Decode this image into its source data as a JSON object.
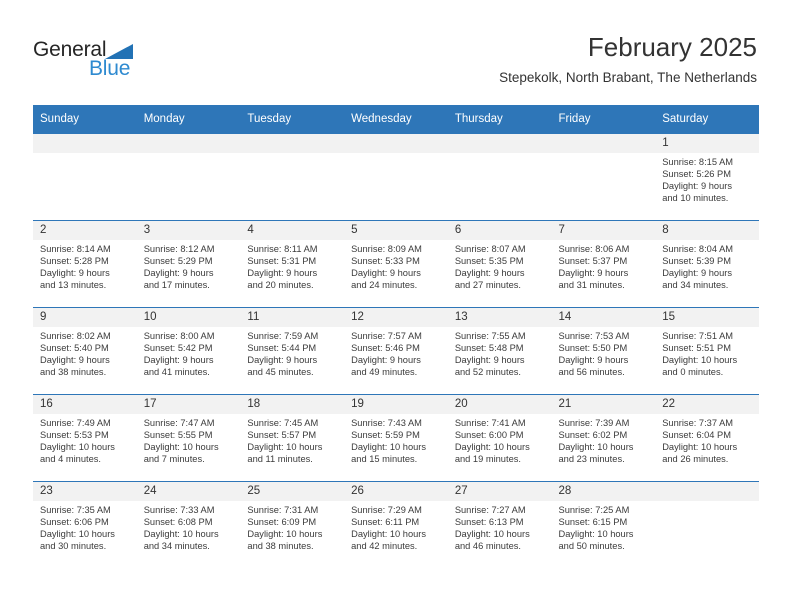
{
  "brand": {
    "name_part1": "General",
    "name_part2": "Blue",
    "triangle_icon": "triangle-icon",
    "accent_color": "#2e76b8",
    "logo_blue": "#2e8ad0"
  },
  "header": {
    "title": "February 2025",
    "subtitle": "Stepekolk, North Brabant, The Netherlands"
  },
  "calendar": {
    "weekday_headers": [
      "Sunday",
      "Monday",
      "Tuesday",
      "Wednesday",
      "Thursday",
      "Friday",
      "Saturday"
    ],
    "weeks": [
      [
        {
          "day": "",
          "lines": []
        },
        {
          "day": "",
          "lines": []
        },
        {
          "day": "",
          "lines": []
        },
        {
          "day": "",
          "lines": []
        },
        {
          "day": "",
          "lines": []
        },
        {
          "day": "",
          "lines": []
        },
        {
          "day": "1",
          "lines": [
            "Sunrise: 8:15 AM",
            "Sunset: 5:26 PM",
            "Daylight: 9 hours",
            "and 10 minutes."
          ]
        }
      ],
      [
        {
          "day": "2",
          "lines": [
            "Sunrise: 8:14 AM",
            "Sunset: 5:28 PM",
            "Daylight: 9 hours",
            "and 13 minutes."
          ]
        },
        {
          "day": "3",
          "lines": [
            "Sunrise: 8:12 AM",
            "Sunset: 5:29 PM",
            "Daylight: 9 hours",
            "and 17 minutes."
          ]
        },
        {
          "day": "4",
          "lines": [
            "Sunrise: 8:11 AM",
            "Sunset: 5:31 PM",
            "Daylight: 9 hours",
            "and 20 minutes."
          ]
        },
        {
          "day": "5",
          "lines": [
            "Sunrise: 8:09 AM",
            "Sunset: 5:33 PM",
            "Daylight: 9 hours",
            "and 24 minutes."
          ]
        },
        {
          "day": "6",
          "lines": [
            "Sunrise: 8:07 AM",
            "Sunset: 5:35 PM",
            "Daylight: 9 hours",
            "and 27 minutes."
          ]
        },
        {
          "day": "7",
          "lines": [
            "Sunrise: 8:06 AM",
            "Sunset: 5:37 PM",
            "Daylight: 9 hours",
            "and 31 minutes."
          ]
        },
        {
          "day": "8",
          "lines": [
            "Sunrise: 8:04 AM",
            "Sunset: 5:39 PM",
            "Daylight: 9 hours",
            "and 34 minutes."
          ]
        }
      ],
      [
        {
          "day": "9",
          "lines": [
            "Sunrise: 8:02 AM",
            "Sunset: 5:40 PM",
            "Daylight: 9 hours",
            "and 38 minutes."
          ]
        },
        {
          "day": "10",
          "lines": [
            "Sunrise: 8:00 AM",
            "Sunset: 5:42 PM",
            "Daylight: 9 hours",
            "and 41 minutes."
          ]
        },
        {
          "day": "11",
          "lines": [
            "Sunrise: 7:59 AM",
            "Sunset: 5:44 PM",
            "Daylight: 9 hours",
            "and 45 minutes."
          ]
        },
        {
          "day": "12",
          "lines": [
            "Sunrise: 7:57 AM",
            "Sunset: 5:46 PM",
            "Daylight: 9 hours",
            "and 49 minutes."
          ]
        },
        {
          "day": "13",
          "lines": [
            "Sunrise: 7:55 AM",
            "Sunset: 5:48 PM",
            "Daylight: 9 hours",
            "and 52 minutes."
          ]
        },
        {
          "day": "14",
          "lines": [
            "Sunrise: 7:53 AM",
            "Sunset: 5:50 PM",
            "Daylight: 9 hours",
            "and 56 minutes."
          ]
        },
        {
          "day": "15",
          "lines": [
            "Sunrise: 7:51 AM",
            "Sunset: 5:51 PM",
            "Daylight: 10 hours",
            "and 0 minutes."
          ]
        }
      ],
      [
        {
          "day": "16",
          "lines": [
            "Sunrise: 7:49 AM",
            "Sunset: 5:53 PM",
            "Daylight: 10 hours",
            "and 4 minutes."
          ]
        },
        {
          "day": "17",
          "lines": [
            "Sunrise: 7:47 AM",
            "Sunset: 5:55 PM",
            "Daylight: 10 hours",
            "and 7 minutes."
          ]
        },
        {
          "day": "18",
          "lines": [
            "Sunrise: 7:45 AM",
            "Sunset: 5:57 PM",
            "Daylight: 10 hours",
            "and 11 minutes."
          ]
        },
        {
          "day": "19",
          "lines": [
            "Sunrise: 7:43 AM",
            "Sunset: 5:59 PM",
            "Daylight: 10 hours",
            "and 15 minutes."
          ]
        },
        {
          "day": "20",
          "lines": [
            "Sunrise: 7:41 AM",
            "Sunset: 6:00 PM",
            "Daylight: 10 hours",
            "and 19 minutes."
          ]
        },
        {
          "day": "21",
          "lines": [
            "Sunrise: 7:39 AM",
            "Sunset: 6:02 PM",
            "Daylight: 10 hours",
            "and 23 minutes."
          ]
        },
        {
          "day": "22",
          "lines": [
            "Sunrise: 7:37 AM",
            "Sunset: 6:04 PM",
            "Daylight: 10 hours",
            "and 26 minutes."
          ]
        }
      ],
      [
        {
          "day": "23",
          "lines": [
            "Sunrise: 7:35 AM",
            "Sunset: 6:06 PM",
            "Daylight: 10 hours",
            "and 30 minutes."
          ]
        },
        {
          "day": "24",
          "lines": [
            "Sunrise: 7:33 AM",
            "Sunset: 6:08 PM",
            "Daylight: 10 hours",
            "and 34 minutes."
          ]
        },
        {
          "day": "25",
          "lines": [
            "Sunrise: 7:31 AM",
            "Sunset: 6:09 PM",
            "Daylight: 10 hours",
            "and 38 minutes."
          ]
        },
        {
          "day": "26",
          "lines": [
            "Sunrise: 7:29 AM",
            "Sunset: 6:11 PM",
            "Daylight: 10 hours",
            "and 42 minutes."
          ]
        },
        {
          "day": "27",
          "lines": [
            "Sunrise: 7:27 AM",
            "Sunset: 6:13 PM",
            "Daylight: 10 hours",
            "and 46 minutes."
          ]
        },
        {
          "day": "28",
          "lines": [
            "Sunrise: 7:25 AM",
            "Sunset: 6:15 PM",
            "Daylight: 10 hours",
            "and 50 minutes."
          ]
        },
        {
          "day": "",
          "lines": []
        }
      ]
    ]
  }
}
